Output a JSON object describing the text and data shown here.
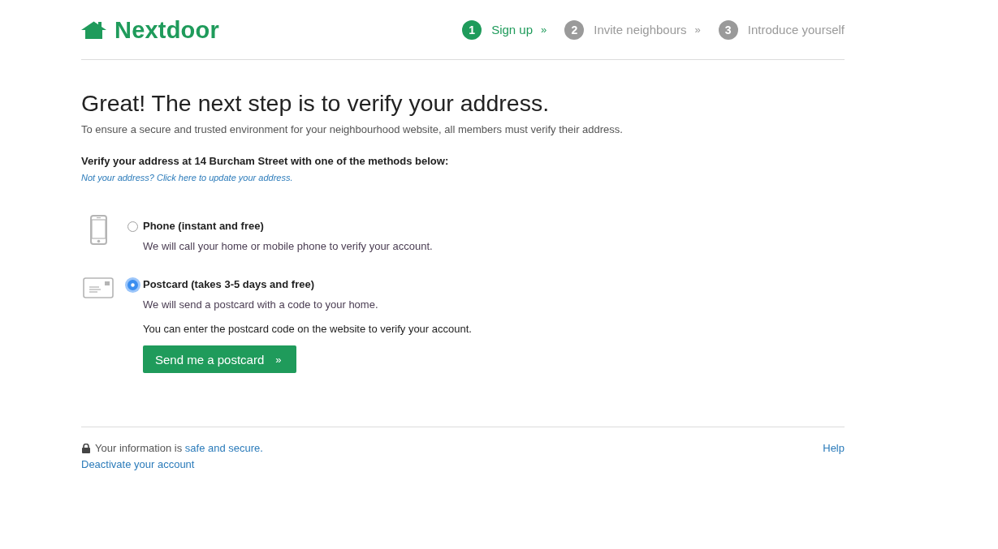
{
  "header": {
    "logo": "Nextdoor",
    "steps": [
      {
        "number": "1",
        "label": "Sign up",
        "separator": "»",
        "selected": true
      },
      {
        "number": "2",
        "label": "Invite neighbours",
        "separator": "»",
        "selected": false
      },
      {
        "number": "3",
        "label": "Introduce yourself",
        "selected": false
      }
    ]
  },
  "heading": "Great! The next step is to verify your address.",
  "intro": "To ensure a secure and trusted environment for your neighbourhood website, all members must verify their address.",
  "verify_prompt": "Verify your address at 14 Burcham Street with one of the methods below:",
  "update_link": "Not your address? Click here to update your address.",
  "methods": [
    {
      "kind": "phone",
      "label": "Phone (instant and free)",
      "selected": false,
      "description": "We will call your home or mobile phone to verify your account."
    },
    {
      "kind": "postcard",
      "label": "Postcard (takes 3-5 days and free)",
      "selected": true,
      "description": "We will send a postcard with a code to your home.",
      "note": "You can enter the postcard code on the website to verify your account.",
      "button": {
        "label": "Send me a postcard",
        "arrow": "»"
      }
    }
  ],
  "footer": {
    "security_note": "Your information is",
    "security_link": "safe and secure.",
    "deactivate_link": "Deactivate your account",
    "help_link": "Help"
  }
}
